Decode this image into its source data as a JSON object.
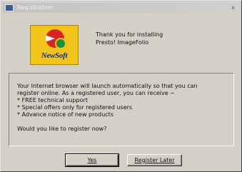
{
  "window": {
    "title": "Registration",
    "close_label": "x"
  },
  "logo": {
    "brand": "NewSoft"
  },
  "header": {
    "line1": "Thank you for installing",
    "line2": "Presto! ImageFolio"
  },
  "message": {
    "line1": "Your Internet browser will launch automatically so that you can",
    "line2": "register online. As a registered user, you can receive ~",
    "bullets": [
      "* FREE technical support",
      "* Special offers only for registered users",
      "* Advance notice of new products"
    ],
    "question": "Would you like to register now?"
  },
  "buttons": {
    "yes_label": "Yes",
    "later_label": "Register Later"
  }
}
